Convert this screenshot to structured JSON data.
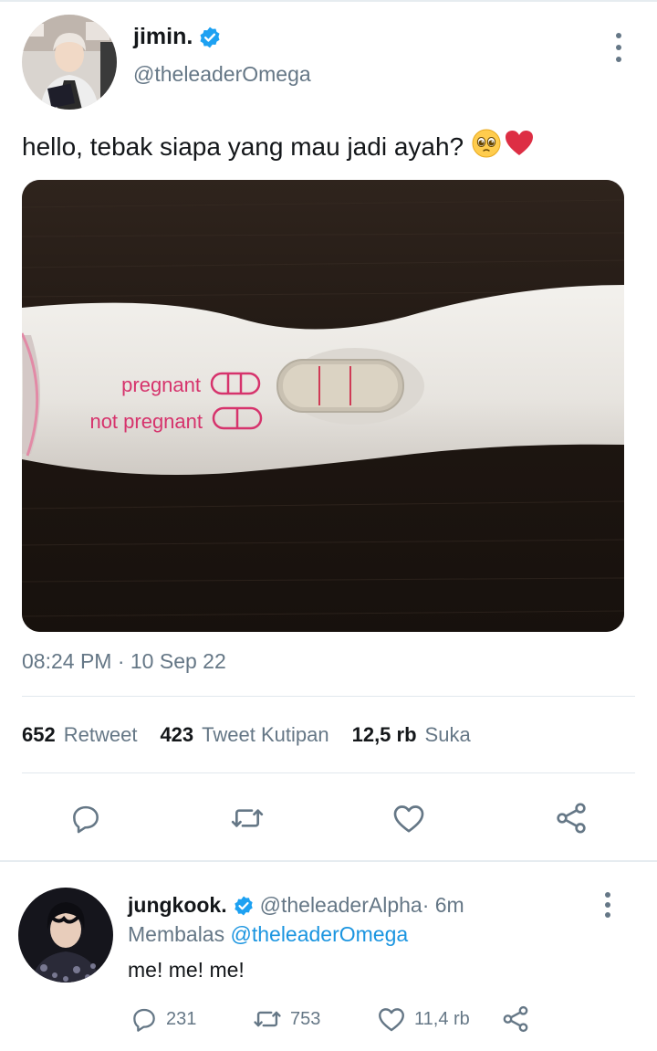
{
  "tweet": {
    "author_name": "jimin.",
    "author_handle": "@theleaderOmega",
    "text": "hello, tebak siapa yang mau jadi ayah?",
    "emojis": [
      "pleading-face-emoji",
      "red-heart-emoji"
    ],
    "photo": {
      "label_pregnant": "pregnant",
      "label_not_pregnant": "not pregnant"
    },
    "timestamp": "08:24 PM · 10 Sep 22",
    "stats": [
      {
        "num": "652",
        "label": "Retweet"
      },
      {
        "num": "423",
        "label": "Tweet Kutipan"
      },
      {
        "num": "12,5 rb",
        "label": "Suka"
      }
    ],
    "actions": [
      "reply-icon",
      "retweet-icon",
      "like-icon",
      "share-icon"
    ]
  },
  "reply": {
    "author_name": "jungkook.",
    "author_handle": "@theleaderAlpha",
    "time": " · 6m",
    "replying_prefix": "Membalas",
    "replying_to": "@theleaderOmega",
    "text": "me! me! me!",
    "counts": {
      "replies": "231",
      "retweets": "753",
      "likes": "11,4 rb"
    }
  },
  "colors": {
    "verified": "#1da1f2",
    "text_primary": "#14171a",
    "text_secondary": "#657786",
    "link": "#1b95e0",
    "test_pink": "#d6336c"
  }
}
